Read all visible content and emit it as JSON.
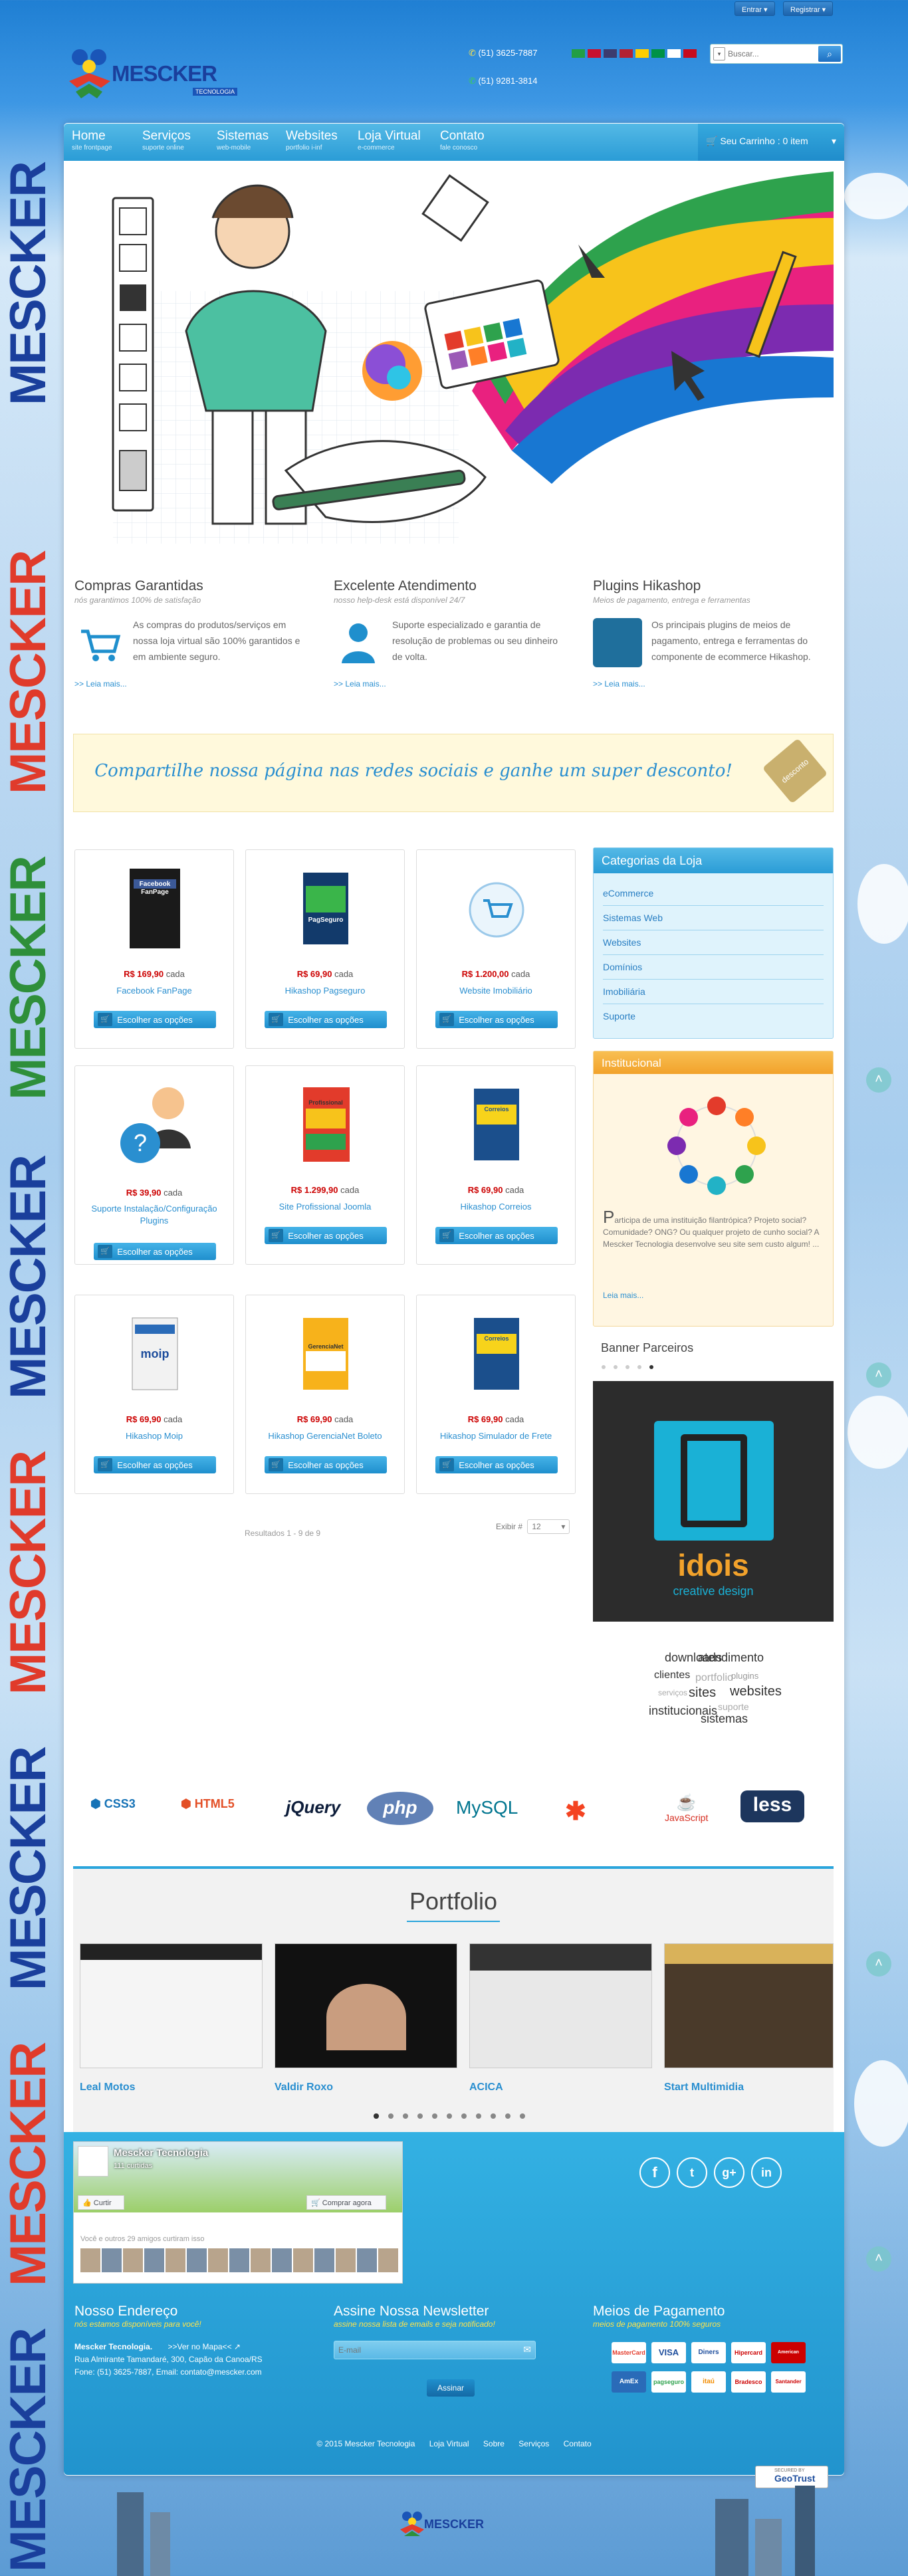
{
  "side_banner_text": "MESCKER",
  "topbar": {
    "login": "Entrar",
    "register": "Registrar"
  },
  "brand": {
    "name": "MESCKER",
    "tagline": "TECNOLOGIA"
  },
  "header": {
    "phone": "(51) 3625-7887",
    "whatsapp": "(51) 9281-3814",
    "search_placeholder": "Buscar..."
  },
  "nav": {
    "items": [
      {
        "label": "Home",
        "sub": "site frontpage"
      },
      {
        "label": "Serviços",
        "sub": "suporte online"
      },
      {
        "label": "Sistemas",
        "sub": "web-mobile"
      },
      {
        "label": "Websites",
        "sub": "portfolio i-inf"
      },
      {
        "label": "Loja Virtual",
        "sub": "e-commerce"
      },
      {
        "label": "Contato",
        "sub": "fale conosco"
      }
    ],
    "cart": "Seu Carrinho : 0 item"
  },
  "features": [
    {
      "title": "Compras Garantidas",
      "sub": "nós garantimos 100% de satisfação",
      "text": "As compras do produtos/serviços em nossa loja virtual são 100% garantidos e em ambiente seguro.",
      "more": ">> Leia mais..."
    },
    {
      "title": "Excelente Atendimento",
      "sub": "nosso help-desk está disponível 24/7",
      "text": "Suporte especializado e garantia de resolução de problemas ou seu dinheiro de volta.",
      "more": ">> Leia mais..."
    },
    {
      "title": "Plugins Hikashop",
      "sub": "Meios de pagamento, entrega e ferramentas",
      "text": "Os principais plugins de meios de pagamento, entrega e ferramentas do componente de ecommerce Hikashop.",
      "more": ">> Leia mais..."
    }
  ],
  "promo": {
    "text": "Compartilhe nossa página nas redes sociais e ganhe um super desconto!",
    "tag": "desconto"
  },
  "products": [
    {
      "price": "R$ 169,90",
      "unit": "cada",
      "name": "Facebook FanPage",
      "button": "Escolher as opções",
      "img": "Facebook FanPage"
    },
    {
      "price": "R$ 69,90",
      "unit": "cada",
      "name": "Hikashop Pagseguro",
      "button": "Escolher as opções",
      "img": "PagSeguro"
    },
    {
      "price": "R$ 1.200,00",
      "unit": "cada",
      "name": "Website Imobiliário",
      "button": "Escolher as opções",
      "img": ""
    },
    {
      "price": "R$ 39,90",
      "unit": "cada",
      "name": "Suporte Instalação/Configuração Plugins",
      "button": "Escolher as opções",
      "img": ""
    },
    {
      "price": "R$ 1.299,90",
      "unit": "cada",
      "name": "Site Profissional Joomla",
      "button": "Escolher as opções",
      "img": "Profissional"
    },
    {
      "price": "R$ 69,90",
      "unit": "cada",
      "name": "Hikashop Correios",
      "button": "Escolher as opções",
      "img": "Correios"
    },
    {
      "price": "R$ 69,90",
      "unit": "cada",
      "name": "Hikashop Moip",
      "button": "Escolher as opções",
      "img": "moip"
    },
    {
      "price": "R$ 69,90",
      "unit": "cada",
      "name": "Hikashop GerenciaNet Boleto",
      "button": "Escolher as opções",
      "img": "GerenciaNet"
    },
    {
      "price": "R$ 69,90",
      "unit": "cada",
      "name": "Hikashop Simulador de Frete",
      "button": "Escolher as opções",
      "img": "Correios"
    }
  ],
  "pagination": {
    "results": "Resultados 1 - 9 de 9",
    "show_label": "Exibir #",
    "show_value": "12"
  },
  "categories": {
    "title": "Categorias da Loja",
    "items": [
      "eCommerce",
      "Sistemas Web",
      "Websites",
      "Domínios",
      "Imobiliária",
      "Suporte"
    ]
  },
  "institucional": {
    "title": "Institucional",
    "initial": "P",
    "text": "articipa de uma instituição filantrópica? Projeto social? Comunidade? ONG? Ou qualquer projeto de cunho social? A Mescker Tecnologia desenvolve seu site sem custo algum! ...",
    "more": "Leia mais..."
  },
  "banner_parceiros": {
    "title": "Banner Parceiros",
    "partner": "idois",
    "partner_sub": "creative design"
  },
  "tag_cloud": [
    "downloads",
    "atendimento",
    "clientes",
    "portfolio",
    "sites",
    "websites",
    "institucionais",
    "sistemas",
    "suporte",
    "plugins",
    "serviços"
  ],
  "tech_logos": [
    "CSS3",
    "HTML5",
    "jQuery",
    "php",
    "MySQL",
    "Joomla",
    "JavaScript",
    "less"
  ],
  "portfolio": {
    "title": "Portfolio",
    "items": [
      "Leal Motos",
      "Valdir Roxo",
      "ACICA",
      "Start Multimidia"
    ]
  },
  "facebook_widget": {
    "page": "Mescker Tecnologia",
    "likes": "111 curtidas",
    "like_btn": "Curtir",
    "buy_btn": "Comprar agora",
    "friends": "Você e outros 29 amigos curtiram isso"
  },
  "social": [
    "f",
    "t",
    "g+",
    "in"
  ],
  "footer": {
    "address": {
      "title": "Nosso Endereço",
      "sub": "nós estamos disponíveis para você!",
      "company": "Mescker Tecnologia.",
      "map": ">>Ver no Mapa<<",
      "street": "Rua Almirante Tamandaré, 300, Capão da Canoa/RS",
      "contact": "Fone: (51) 3625-7887, Email: contato@mescker.com"
    },
    "newsletter": {
      "title": "Assine Nossa Newsletter",
      "sub": "assine nossa lista de emails e seja notificado!",
      "placeholder": "E-mail",
      "button": "Assinar"
    },
    "payment": {
      "title": "Meios de Pagamento",
      "sub": "meios de pagamento 100% seguros",
      "methods": [
        "MasterCard",
        "VISA",
        "Diners",
        "Hipercard",
        "American Express",
        "AmEx",
        "pagseguro",
        "itaú",
        "Bradesco",
        "Santander"
      ]
    },
    "copyright": "© 2015 Mescker Tecnologia",
    "links": [
      "Loja Virtual",
      "Sobre",
      "Serviços",
      "Contato"
    ]
  },
  "secured_badge": {
    "label": "SECURED BY",
    "brand": "GeoTrust"
  },
  "colors": {
    "nav": "#2a9cd6",
    "accent": "#2a8fd0",
    "price": "#cc0000",
    "footer": "#2aa5dc"
  }
}
